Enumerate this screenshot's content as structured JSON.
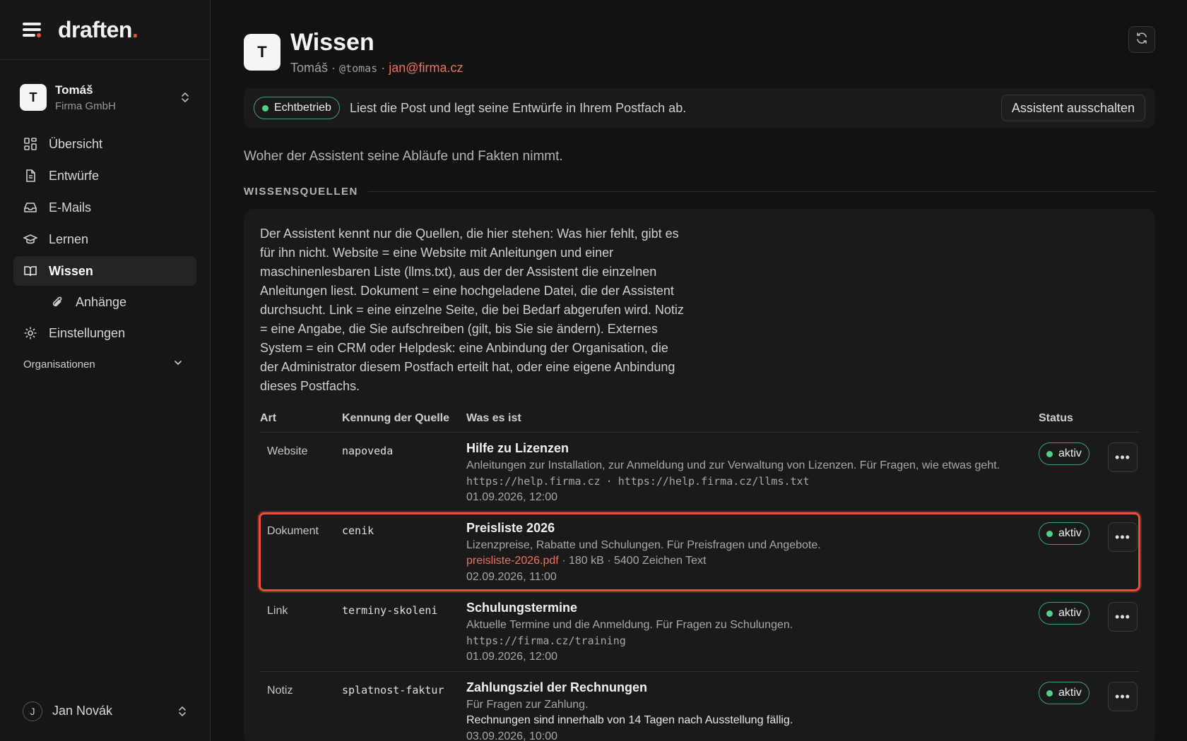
{
  "brand": {
    "name": "draften",
    "dot": "."
  },
  "account": {
    "initial": "T",
    "name": "Tomáš",
    "org": "Firma GmbH"
  },
  "nav": [
    {
      "label": "Übersicht",
      "icon": "grid-icon"
    },
    {
      "label": "Entwürfe",
      "icon": "document-icon"
    },
    {
      "label": "E-Mails",
      "icon": "inbox-icon"
    },
    {
      "label": "Lernen",
      "icon": "graduation-cap-icon"
    },
    {
      "label": "Wissen",
      "icon": "book-open-icon",
      "active": true
    },
    {
      "label": "Anhänge",
      "icon": "paperclip-icon",
      "sub": true
    },
    {
      "label": "Einstellungen",
      "icon": "gear-icon"
    }
  ],
  "organisations_label": "Organisationen",
  "user": {
    "initial": "J",
    "name": "Jan Novák"
  },
  "page": {
    "initial": "T",
    "title": "Wissen",
    "owner": "Tomáš",
    "handle": "@tomas",
    "email": "jan@firma.cz",
    "separator": "·"
  },
  "status": {
    "badge": "Echtbetrieb",
    "message": "Liest die Post und legt seine Entwürfe in Ihrem Postfach ab.",
    "button": "Assistent ausschalten"
  },
  "intro": "Woher der Assistent seine Abläufe und Fakten nimmt.",
  "section_title": "WISSENSQUELLEN",
  "description": "Der Assistent kennt nur die Quellen, die hier stehen: Was hier fehlt, gibt es für ihn nicht. Website = eine Website mit Anleitungen und einer maschinenlesbaren Liste (llms.txt), aus der der Assistent die einzelnen Anleitungen liest. Dokument = eine hochgeladene Datei, die der Assistent durchsucht. Link = eine einzelne Seite, die bei Bedarf abgerufen wird. Notiz = eine Angabe, die Sie aufschreiben (gilt, bis Sie sie ändern). Externes System = ein CRM oder Helpdesk: eine Anbindung der Organisation, die der Administrator diesem Postfach erteilt hat, oder eine eigene Anbindung dieses Postfachs.",
  "table": {
    "headers": {
      "art": "Art",
      "id": "Kennung der Quelle",
      "what": "Was es ist",
      "status": "Status"
    },
    "rows": [
      {
        "art": "Website",
        "id": "napoveda",
        "title": "Hilfe zu Lizenzen",
        "desc": "Anleitungen zur Installation, zur Anmeldung und zur Verwaltung von Lizenzen. Für Fragen, wie etwas geht.",
        "url1": "https://help.firma.cz",
        "sep": "·",
        "url2": "https://help.firma.cz/llms.txt",
        "date": "01.09.2026, 12:00",
        "status": "aktiv"
      },
      {
        "art": "Dokument",
        "id": "cenik",
        "title": "Preisliste 2026",
        "desc": "Lizenzpreise, Rabatte und Schulungen. Für Preisfragen und Angebote.",
        "file": "preisliste-2026.pdf",
        "meta": " · 180 kB · 5400 Zeichen Text",
        "date": "02.09.2026, 11:00",
        "status": "aktiv"
      },
      {
        "art": "Link",
        "id": "terminy-skoleni",
        "title": "Schulungstermine",
        "desc": "Aktuelle Termine und die Anmeldung. Für Fragen zu Schulungen.",
        "url1": "https://firma.cz/training",
        "date": "01.09.2026, 12:00",
        "status": "aktiv"
      },
      {
        "art": "Notiz",
        "id": "splatnost-faktur",
        "title": "Zahlungsziel der Rechnungen",
        "desc": "Für Fragen zur Zahlung.",
        "note": "Rechnungen sind innerhalb von 14 Tagen nach Ausstellung fällig.",
        "date": "03.09.2026, 10:00",
        "status": "aktiv"
      }
    ]
  },
  "colors": {
    "accent": "#e8523a",
    "active_green": "#4fd08c",
    "highlight": "#f04a38"
  }
}
